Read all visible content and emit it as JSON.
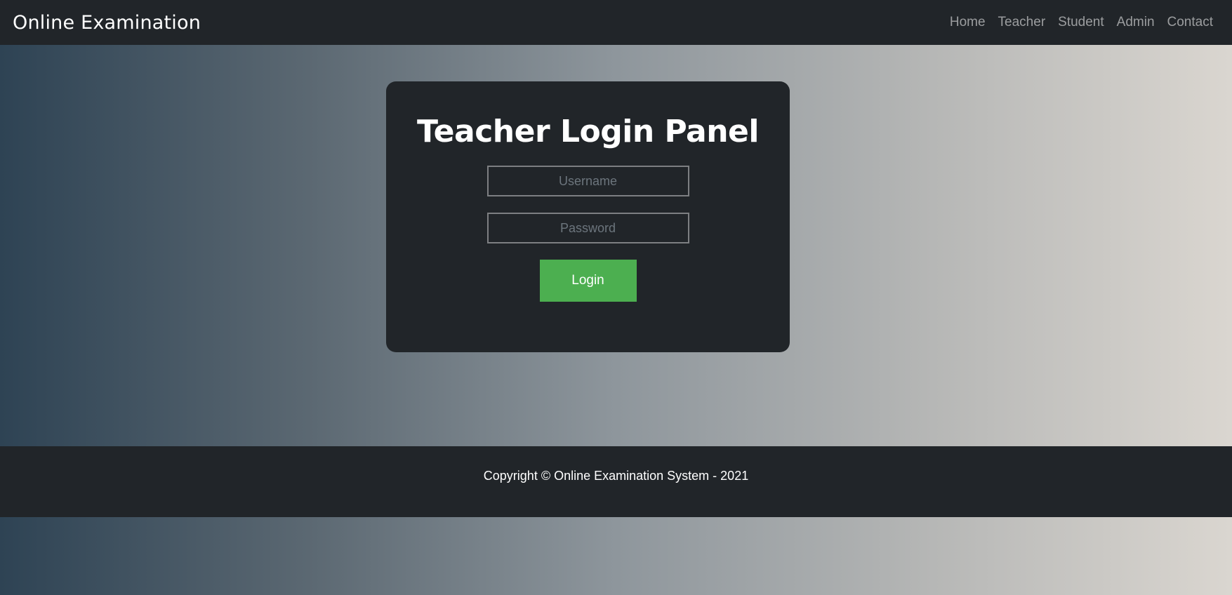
{
  "navbar": {
    "brand": "Online Examination",
    "links": [
      "Home",
      "Teacher",
      "Student",
      "Admin",
      "Contact"
    ]
  },
  "login_panel": {
    "title": "Teacher Login Panel",
    "username_placeholder": "Username",
    "password_placeholder": "Password",
    "login_label": "Login"
  },
  "footer": {
    "text": "Copyright © Online Examination System - 2021"
  },
  "colors": {
    "navbar_bg": "#212529",
    "card_bg": "#212529",
    "login_button": "#4caf50",
    "gradient_start": "#2e4354",
    "gradient_end": "#dad6d0"
  }
}
